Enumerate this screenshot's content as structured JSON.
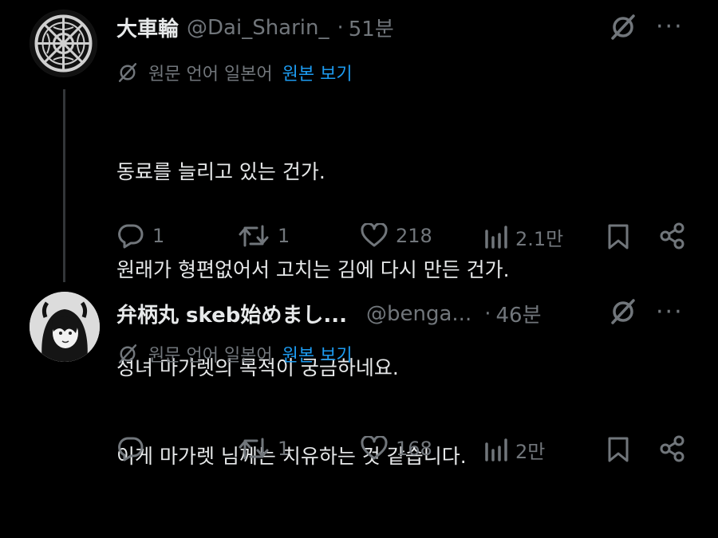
{
  "tweets": [
    {
      "name": "大車輪",
      "handle": "@Dai_Sharin_",
      "separator": "·",
      "time": "51분",
      "translate": {
        "text": "원문 언어 일본어",
        "link": "원본 보기"
      },
      "lines": [
        "동료를 늘리고 있는 건가.",
        "원래가 형편없어서 고치는 김에 다시 만든 건가.",
        "성녀 마가렛의 목적이 궁금하네요."
      ],
      "stats": {
        "replies": "1",
        "retweets": "1",
        "likes": "218",
        "views": "2.1만"
      }
    },
    {
      "name": "弁柄丸 skeb始めまし...",
      "handle": "@benga...",
      "separator": "·",
      "time": "46분",
      "translate": {
        "text": "원문 언어 일본어",
        "link": "원본 보기"
      },
      "lines": [
        "이게 마가렛 님께는 치유하는 것 같습니다."
      ],
      "stats": {
        "replies": "",
        "retweets": "1",
        "likes": "168",
        "views": "2만"
      }
    }
  ],
  "more_label": "···",
  "colors": {
    "text": "#e7e9ea",
    "muted": "#71767b",
    "link": "#1d9bf0",
    "background": "#000000"
  }
}
